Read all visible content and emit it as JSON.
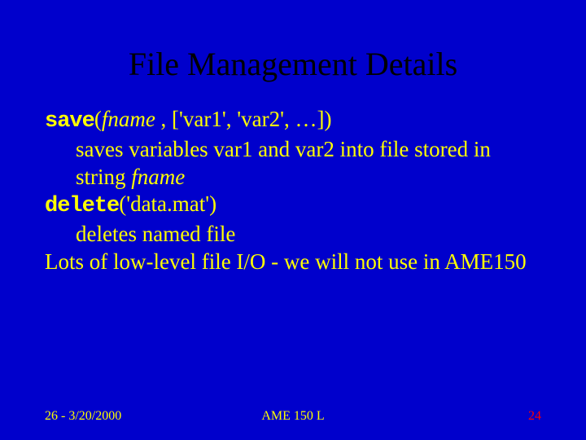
{
  "title": "File Management Details",
  "body": {
    "line1_save": "save",
    "line1_open": "(",
    "line1_fname": "fname",
    "line1_rest": " , ['var1', 'var2', …])",
    "line2": "saves variables var1 and var2 into file stored in string ",
    "line2_fname": "fname",
    "line3_delete": "delete",
    "line3_rest": "('data.mat')",
    "line4": "deletes named file",
    "line5": "Lots of low-level file I/O - we will not use in AME150"
  },
  "footer": {
    "left": "26 - 3/20/2000",
    "center": "AME 150 L",
    "right": "24"
  }
}
